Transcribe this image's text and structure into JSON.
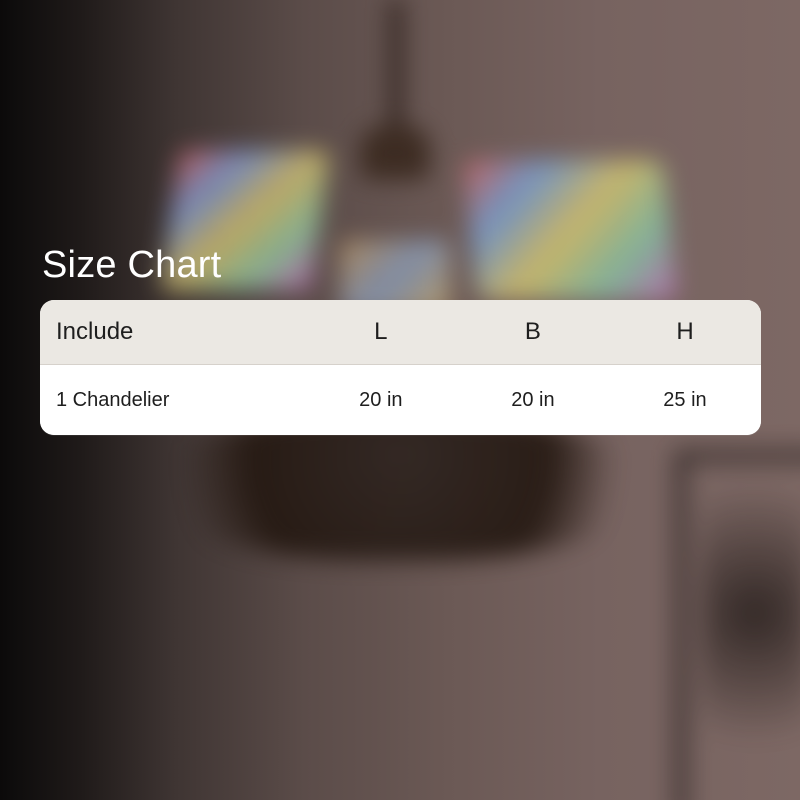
{
  "title": "Size Chart",
  "table": {
    "headers": [
      "Include",
      "L",
      "B",
      "H"
    ],
    "rows": [
      [
        "1 Chandelier",
        "20 in",
        "20 in",
        "25 in"
      ]
    ]
  },
  "colors": {
    "title": "#ffffff",
    "header_bg": "#ebe8e3",
    "body_bg": "#ffffff",
    "text": "#1e1e1e"
  }
}
